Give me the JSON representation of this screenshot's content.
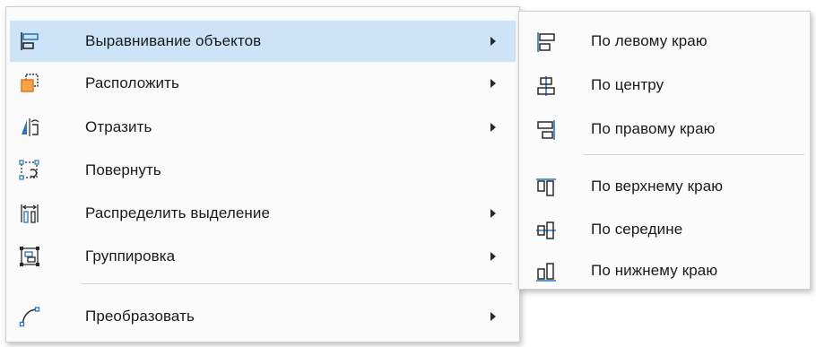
{
  "main_menu": {
    "items": [
      {
        "label": "Выравнивание объектов",
        "has_submenu": true,
        "icon": "align-objects-icon"
      },
      {
        "label": "Расположить",
        "has_submenu": true,
        "icon": "arrange-icon"
      },
      {
        "label": "Отразить",
        "has_submenu": true,
        "icon": "flip-icon"
      },
      {
        "label": "Повернуть",
        "has_submenu": false,
        "icon": "rotate-icon"
      },
      {
        "label": "Распределить выделение",
        "has_submenu": true,
        "icon": "distribute-icon"
      },
      {
        "label": "Группировка",
        "has_submenu": true,
        "icon": "group-icon"
      },
      {
        "label": "Преобразовать",
        "has_submenu": true,
        "icon": "convert-icon"
      }
    ]
  },
  "sub_menu": {
    "items": [
      {
        "label": "По левому краю",
        "icon": "align-left-icon"
      },
      {
        "label": "По центру",
        "icon": "align-center-icon"
      },
      {
        "label": "По правому краю",
        "icon": "align-right-icon"
      },
      {
        "label": "По верхнему краю",
        "icon": "align-top-icon"
      },
      {
        "label": "По середине",
        "icon": "align-middle-icon"
      },
      {
        "label": "По нижнему краю",
        "icon": "align-bottom-icon"
      }
    ]
  },
  "colors": {
    "highlight": "#cde3f7",
    "icon_dark": "#2b2b2b",
    "icon_blue": "#2a73c4",
    "icon_orange": "#f28c1e"
  }
}
